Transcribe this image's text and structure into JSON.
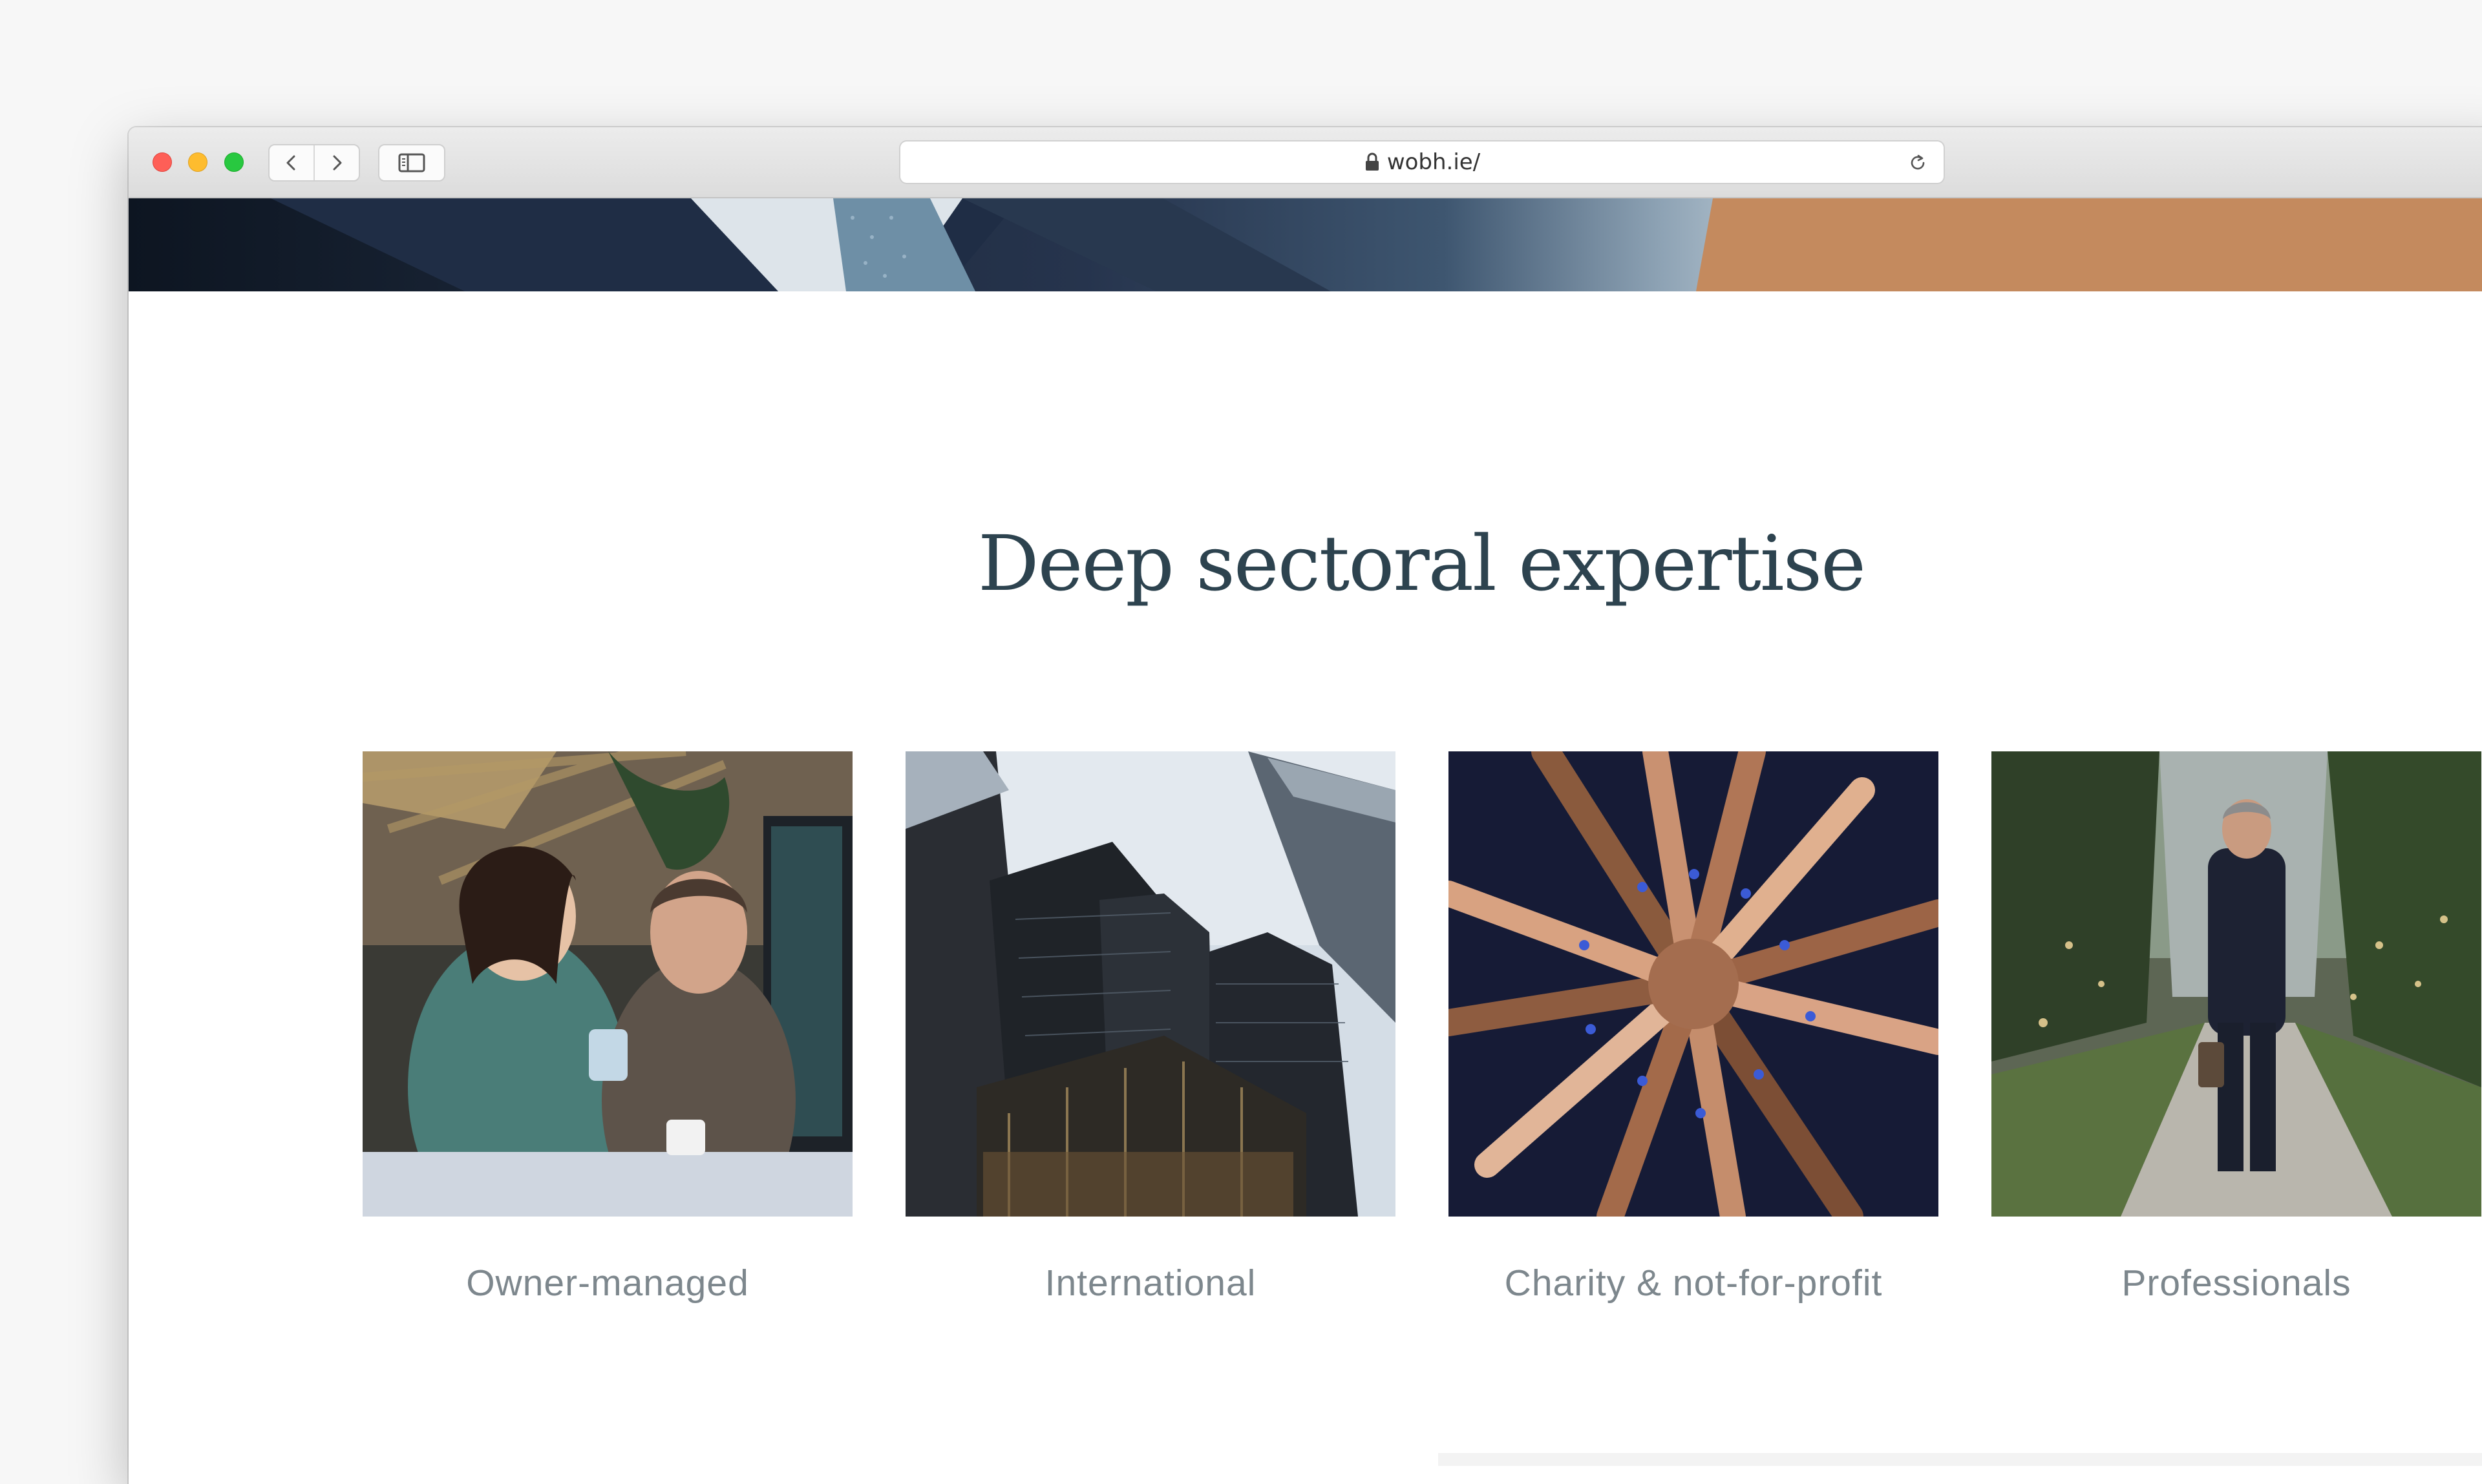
{
  "browser": {
    "url": "wobh.ie/",
    "buttons": {
      "close": "close",
      "minimize": "minimize",
      "maximize": "maximize",
      "back": "chevron-left-icon",
      "forward": "chevron-right-icon",
      "sidebar": "sidebar-icon",
      "reload": "reload-icon",
      "lock": "lock-icon"
    }
  },
  "hero": {
    "accent_color": "#c48a5e"
  },
  "section": {
    "title": "Deep sectoral expertise",
    "title_color": "#2d434f",
    "label_color": "#7d878d"
  },
  "sectors": [
    {
      "label": "Owner-managed"
    },
    {
      "label": "International"
    },
    {
      "label": "Charity & not-for-profit"
    },
    {
      "label": "Professionals"
    }
  ]
}
